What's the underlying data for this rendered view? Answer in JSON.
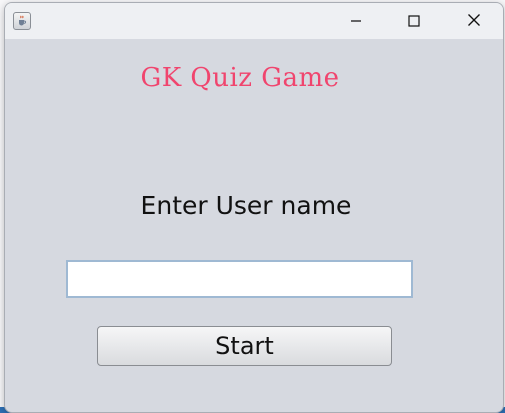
{
  "window": {
    "title": "",
    "icon": "java-cup-icon"
  },
  "controls": {
    "minimize_icon": "minimize-icon",
    "maximize_icon": "maximize-icon",
    "close_icon": "close-icon"
  },
  "main": {
    "title": "GK Quiz Game",
    "prompt": "Enter User name",
    "username_value": "",
    "username_placeholder": "",
    "start_label": "Start"
  },
  "colors": {
    "title": "#f0456e",
    "window_background": "#d6d9e0",
    "input_border": "#9fb9d3"
  }
}
